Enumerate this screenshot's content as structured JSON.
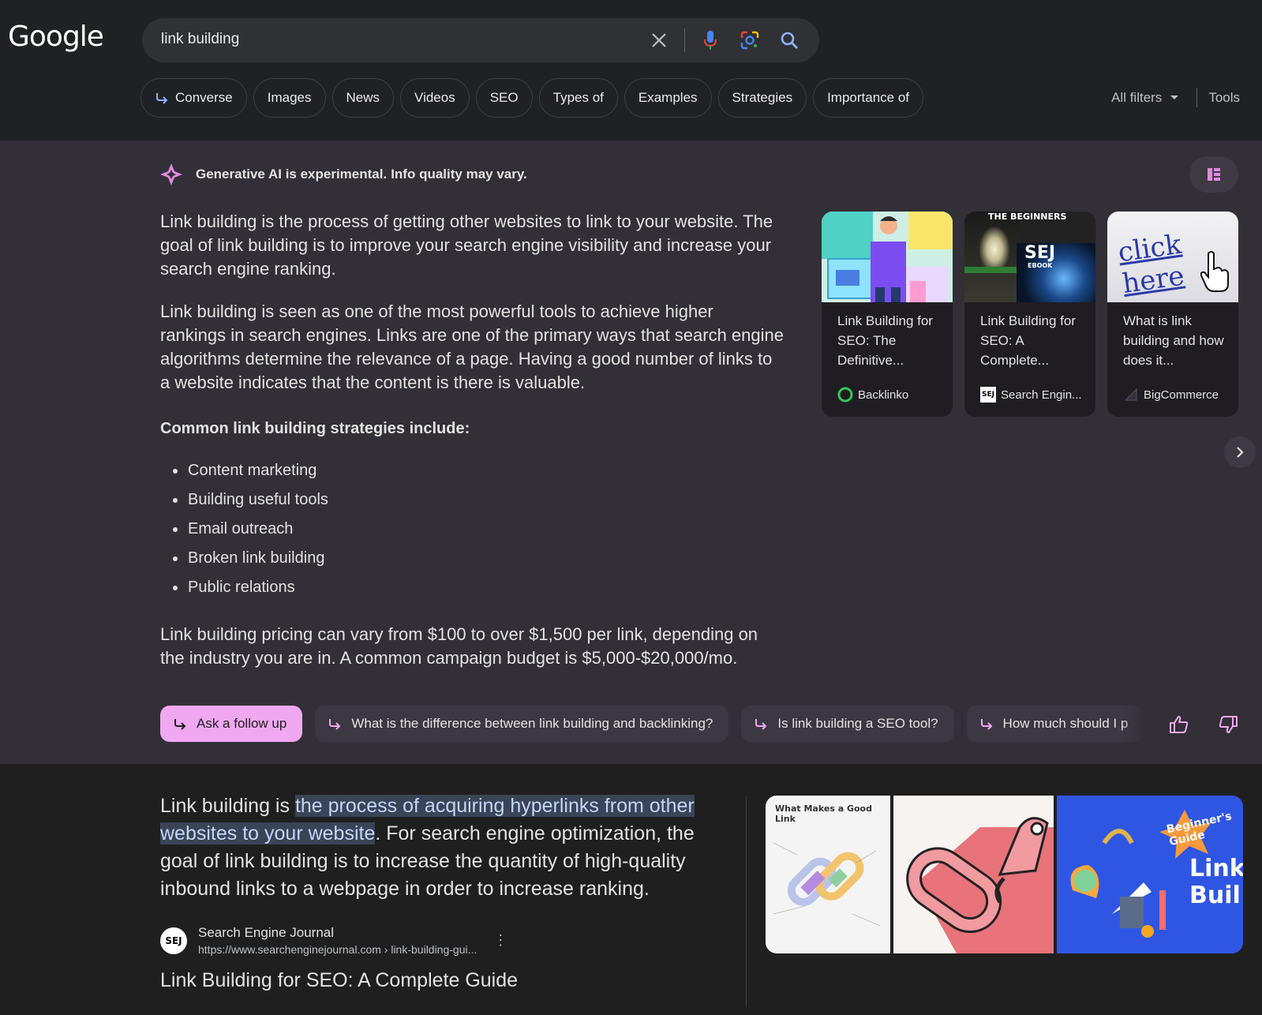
{
  "logo": "Google",
  "search": {
    "query": "link building"
  },
  "chips": [
    "Converse",
    "Images",
    "News",
    "Videos",
    "SEO",
    "Types of",
    "Examples",
    "Strategies",
    "Importance of"
  ],
  "filters": {
    "all_filters": "All filters",
    "tools": "Tools"
  },
  "ai": {
    "banner_bold": "Generative AI is experimental.",
    "banner_rest": "Info quality may vary.",
    "para1": "Link building is the process of getting other websites to link to your website. The goal of link building is to improve your search engine visibility and increase your search engine ranking.",
    "para2": "Link building is seen as one of the most powerful tools to achieve higher rankings in search engines. Links are one of the primary ways that search engine algorithms determine the relevance of a page. Having a good number of links to a website indicates that the content is there is valuable.",
    "strategies_heading": "Common link building strategies include:",
    "strategies": [
      "Content marketing",
      "Building useful tools",
      "Email outreach",
      "Broken link building",
      "Public relations"
    ],
    "pricing": "Link building pricing can vary from $100 to over $1,500 per link, depending on the industry you are in. A common campaign budget is $5,000-$20,000/mo.",
    "cards": [
      {
        "title": "Link Building for SEO: The Definitive...",
        "source": "Backlinko"
      },
      {
        "title": "Link Building for SEO: A Complete...",
        "source": "Search Engin...",
        "img_text": "SEJ",
        "img_sub": "EBOOK",
        "img_top": "THE BEGINNERS"
      },
      {
        "title": "What is link building and how does it...",
        "source": "BigCommerce",
        "img_text": "click here"
      }
    ],
    "followups": {
      "ask": "Ask a follow up",
      "q1": "What is the difference between link building and backlinking?",
      "q2": "Is link building a SEO tool?",
      "q3": "How much should I p"
    }
  },
  "snippet": {
    "before": "Link building is ",
    "highlight": "the process of acquiring hyperlinks from other websites to your website",
    "after": ". For search engine optimization, the goal of link building is to increase the quantity of high-quality inbound links to a webpage in order to increase ranking.",
    "source_name": "Search Engine Journal",
    "source_url": "https://www.searchenginejournal.com › link-building-gui...",
    "favicon": "SEJ",
    "title": "Link Building for SEO: A Complete Guide"
  },
  "image_tiles": {
    "tile1_title": "What Makes a Good Link",
    "tile3_badge": "Beginner's Guide",
    "tile3_text": "Link Buil"
  },
  "colors": {
    "accent_pink": "#f0a8f0",
    "ai_panel": "#322f37",
    "header": "#202124",
    "highlight": "#394457"
  }
}
